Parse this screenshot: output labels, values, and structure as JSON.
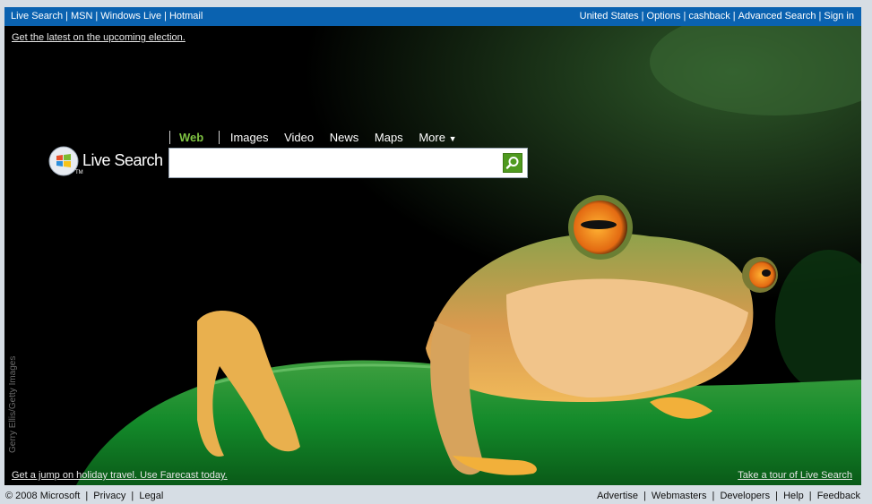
{
  "topbar": {
    "left_links": [
      "Live Search",
      "MSN",
      "Windows Live",
      "Hotmail"
    ],
    "right_links": [
      "United States",
      "Options",
      "cashback",
      "Advanced Search",
      "Sign in"
    ]
  },
  "election_link": "Get the latest on the upcoming election.",
  "logo": {
    "text": "Live Search",
    "tm": "TM"
  },
  "tabs": {
    "web": "Web",
    "images": "Images",
    "video": "Video",
    "news": "News",
    "maps": "Maps",
    "more": "More"
  },
  "search": {
    "value": "",
    "placeholder": ""
  },
  "credit": "Gerry Ellis/Getty Images",
  "promo_left": "Get a jump on holiday travel. Use Farecast today.",
  "promo_right": "Take a tour of Live Search",
  "footer": {
    "copyright": "© 2008 Microsoft",
    "left_links": [
      "Privacy",
      "Legal"
    ],
    "right_links": [
      "Advertise",
      "Webmasters",
      "Developers",
      "Help",
      "Feedback"
    ]
  },
  "colors": {
    "topbar": "#0a62b0",
    "accent_green": "#7ec242",
    "search_button": "#4f9a1f"
  },
  "icons": {
    "windows_logo": "windows-logo-icon",
    "search": "magnifier-icon",
    "dropdown": "caret-down-icon"
  }
}
